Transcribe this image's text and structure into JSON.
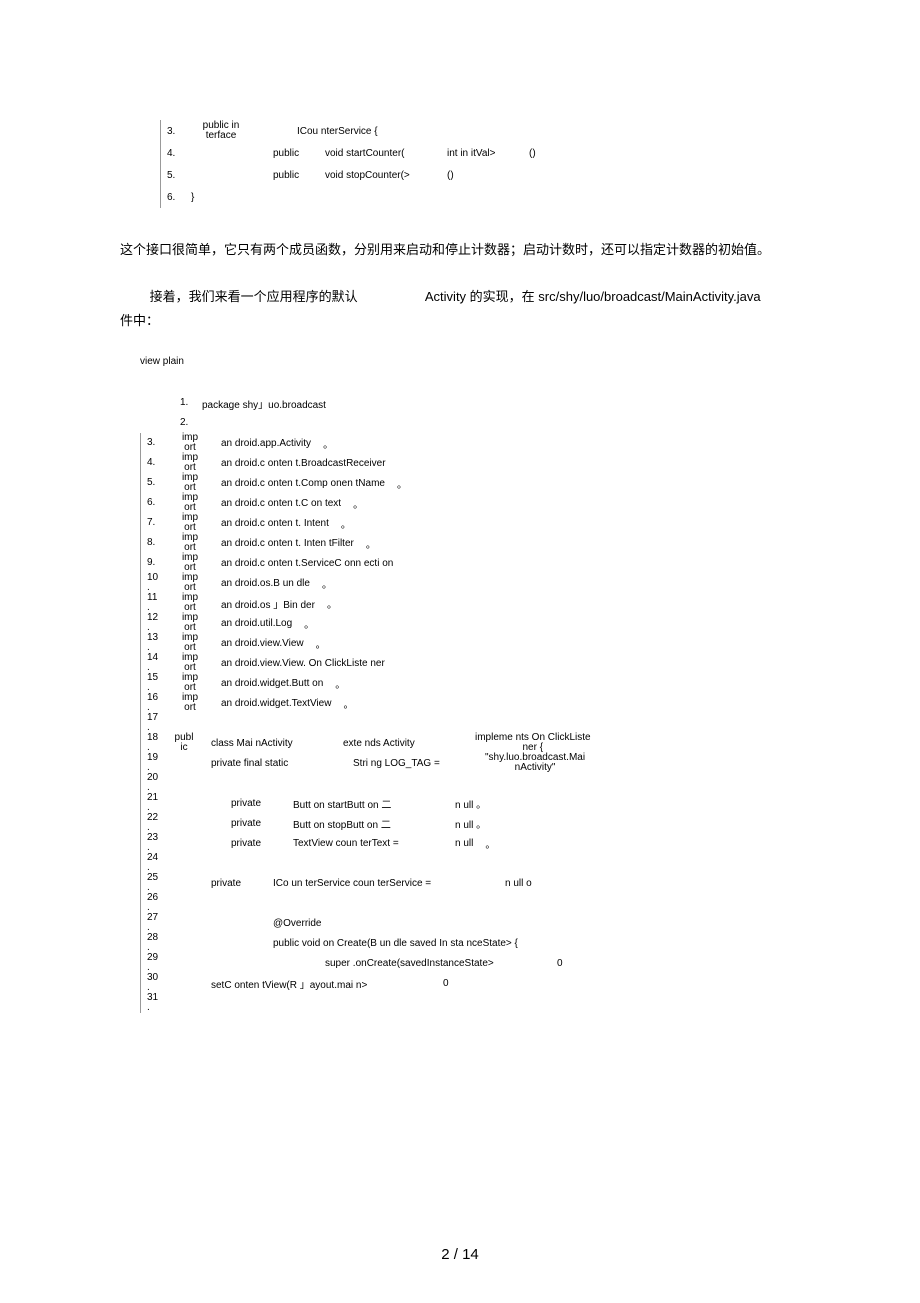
{
  "top_code": {
    "rows": [
      {
        "num": "3.",
        "cells": [
          "public in\nterface",
          "ICou nterService {"
        ]
      },
      {
        "num": "4.",
        "cells": [
          "",
          "public",
          "void startCounter(",
          "int in itVal>",
          "()"
        ]
      },
      {
        "num": "5.",
        "cells": [
          "",
          "public",
          "void stopCounter(>",
          "()"
        ]
      },
      {
        "num": "6.",
        "cells": [
          "}"
        ]
      }
    ]
  },
  "para1": "这个接口很简单，它只有两个成员函数，分别用来启动和停止计数器；启动计数时，还可以指定计数器的初始值。",
  "para2_pre": "接着，我们来看一个应用程序的默认",
  "para2_mid": "Activity 的实现，在  src/shy/luo/broadcast/MainActivity.java",
  "para2_post": "件中：",
  "viewplain": "view plain",
  "big_code": {
    "rows": [
      {
        "num": "1.",
        "cells": [
          "package shy」uo.broadcast"
        ]
      },
      {
        "num": "2.",
        "cells": [
          ""
        ]
      },
      {
        "num": "3.",
        "cells": [
          "imp\nort",
          "an droid.app.Activity",
          "。"
        ]
      },
      {
        "num": "4.",
        "cells": [
          "imp\nort",
          "an droid.c onten t.BroadcastReceiver"
        ]
      },
      {
        "num": "5.",
        "cells": [
          "imp\nort",
          "an droid.c onten t.Comp onen tName",
          "。"
        ]
      },
      {
        "num": "6.",
        "cells": [
          "imp\nort",
          "an droid.c onten t.C on text",
          "。"
        ]
      },
      {
        "num": "7.",
        "cells": [
          "imp\nort",
          "an droid.c onten t. Intent",
          "。"
        ]
      },
      {
        "num": "8.",
        "cells": [
          "imp\nort",
          "an droid.c onten t. Inten tFilter",
          "。"
        ]
      },
      {
        "num": "9.",
        "cells": [
          "imp\nort",
          "an droid.c onten t.ServiceC onn ecti on"
        ]
      },
      {
        "num": "10\n.",
        "cells": [
          "imp\nort",
          "an droid.os.B un dle",
          "。"
        ]
      },
      {
        "num": "11\n.",
        "cells": [
          "imp\nort",
          "an droid.os 」Bin der",
          "。"
        ]
      },
      {
        "num": "12\n.",
        "cells": [
          "imp\nort",
          "an droid.util.Log",
          "。"
        ]
      },
      {
        "num": "13\n.",
        "cells": [
          "imp\nort",
          "an droid.view.View",
          "。"
        ]
      },
      {
        "num": "14\n.",
        "cells": [
          "imp\nort",
          "an droid.view.View. On ClickListe ner"
        ]
      },
      {
        "num": "15\n.",
        "cells": [
          "imp\nort",
          "an droid.widget.Butt on",
          "。"
        ]
      },
      {
        "num": "16\n.",
        "cells": [
          "imp\nort",
          "an droid.widget.TextView",
          "。"
        ]
      },
      {
        "num": "17\n.",
        "cells": [
          ""
        ]
      },
      {
        "num": "18\n.",
        "cells": [
          "publ\nic",
          "class Mai nActivity",
          "exte nds Activity",
          "impleme nts On ClickListe\nner {"
        ]
      },
      {
        "num": "19\n.",
        "cells": [
          "",
          "private final static",
          "Stri ng LOG_TAG =",
          "\"shy.luo.broadcast.Mai\nnActivity\""
        ]
      },
      {
        "num": "20\n.",
        "cells": [
          ""
        ]
      },
      {
        "num": "21\n.",
        "cells": [
          "",
          "private",
          "Butt on startButt on 二",
          "n ull 。"
        ]
      },
      {
        "num": "22\n.",
        "cells": [
          "",
          "private",
          "Butt on stopButt on 二",
          "n ull 。"
        ]
      },
      {
        "num": "23\n.",
        "cells": [
          "",
          "private",
          "TextView coun terText =",
          "n ull",
          "。"
        ]
      },
      {
        "num": "24\n.",
        "cells": [
          ""
        ]
      },
      {
        "num": "25\n.",
        "cells": [
          "",
          "private",
          "ICo un terService coun terService =",
          "n ull o"
        ]
      },
      {
        "num": "26\n.",
        "cells": [
          ""
        ]
      },
      {
        "num": "27\n.",
        "cells": [
          "",
          "",
          "@Override"
        ]
      },
      {
        "num": "28\n.",
        "cells": [
          "",
          "",
          "public void on Create(B un dle saved In sta nceState> {"
        ]
      },
      {
        "num": "29\n.",
        "cells": [
          "",
          "",
          "",
          "super .onCreate(savedInstanceState>",
          "0"
        ]
      },
      {
        "num": "30\n.",
        "cells": [
          "",
          "setC onten tView(R 」ayout.mai n>",
          "0"
        ]
      },
      {
        "num": "31\n.",
        "cells": [
          ""
        ]
      }
    ]
  },
  "page_number": "2 / 14"
}
